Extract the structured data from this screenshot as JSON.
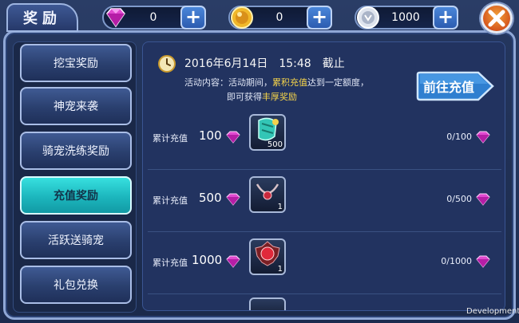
{
  "header": {
    "title": "奖励",
    "currencies": [
      {
        "icon": "pink-gem-icon",
        "value": "0"
      },
      {
        "icon": "gold-coin-icon",
        "value": "0"
      },
      {
        "icon": "silver-coin-icon",
        "value": "1000"
      }
    ]
  },
  "sidebar": {
    "items": [
      {
        "label": "挖宝奖励",
        "active": false
      },
      {
        "label": "神宠来袭",
        "active": false
      },
      {
        "label": "骑宠洗练奖励",
        "active": false
      },
      {
        "label": "充值奖励",
        "active": true
      },
      {
        "label": "活跃送骑宠",
        "active": false
      },
      {
        "label": "礼包兑换",
        "active": false
      }
    ]
  },
  "event": {
    "deadline": "2016年6月14日　15:48　截止",
    "desc_prefix": "活动内容：活动期间，",
    "desc_highlight": "累积充值",
    "desc_middle": "达到一定额度，",
    "desc_line2_prefix": "即可获得",
    "desc_line2_highlight": "丰厚奖励",
    "goto_label": "前往充值"
  },
  "rewards": [
    {
      "label": "累计充值",
      "amount": "100",
      "reward_icon": "teal-shield-icon",
      "reward_qty": "500",
      "progress": "0/100"
    },
    {
      "label": "累计充值",
      "amount": "500",
      "reward_icon": "red-necklace-icon",
      "reward_qty": "1",
      "progress": "0/500"
    },
    {
      "label": "累计充值",
      "amount": "1000",
      "reward_icon": "red-orb-icon",
      "reward_qty": "1",
      "progress": "0/1000"
    }
  ],
  "footer": {
    "watermark": "Development"
  },
  "colors": {
    "accent_teal": "#1cb6bd",
    "highlight_yellow": "#f6d44a",
    "gem_pink": "#e040c8"
  }
}
